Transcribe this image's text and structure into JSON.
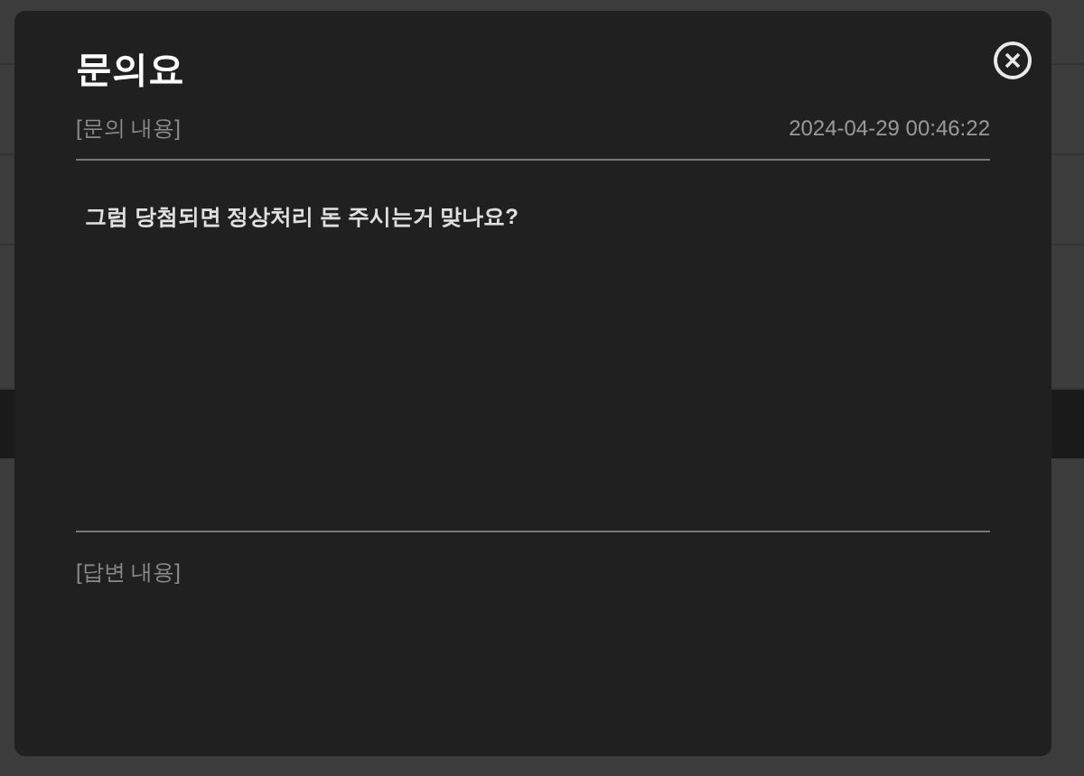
{
  "modal": {
    "title": "문의요",
    "question_label": "[문의 내용]",
    "date": "2024-04-29 00:46:22",
    "question": "그럼 당첨되면 정상처리 돈 주시는거 맞나요?",
    "answer_label": "[답변 내용]"
  }
}
